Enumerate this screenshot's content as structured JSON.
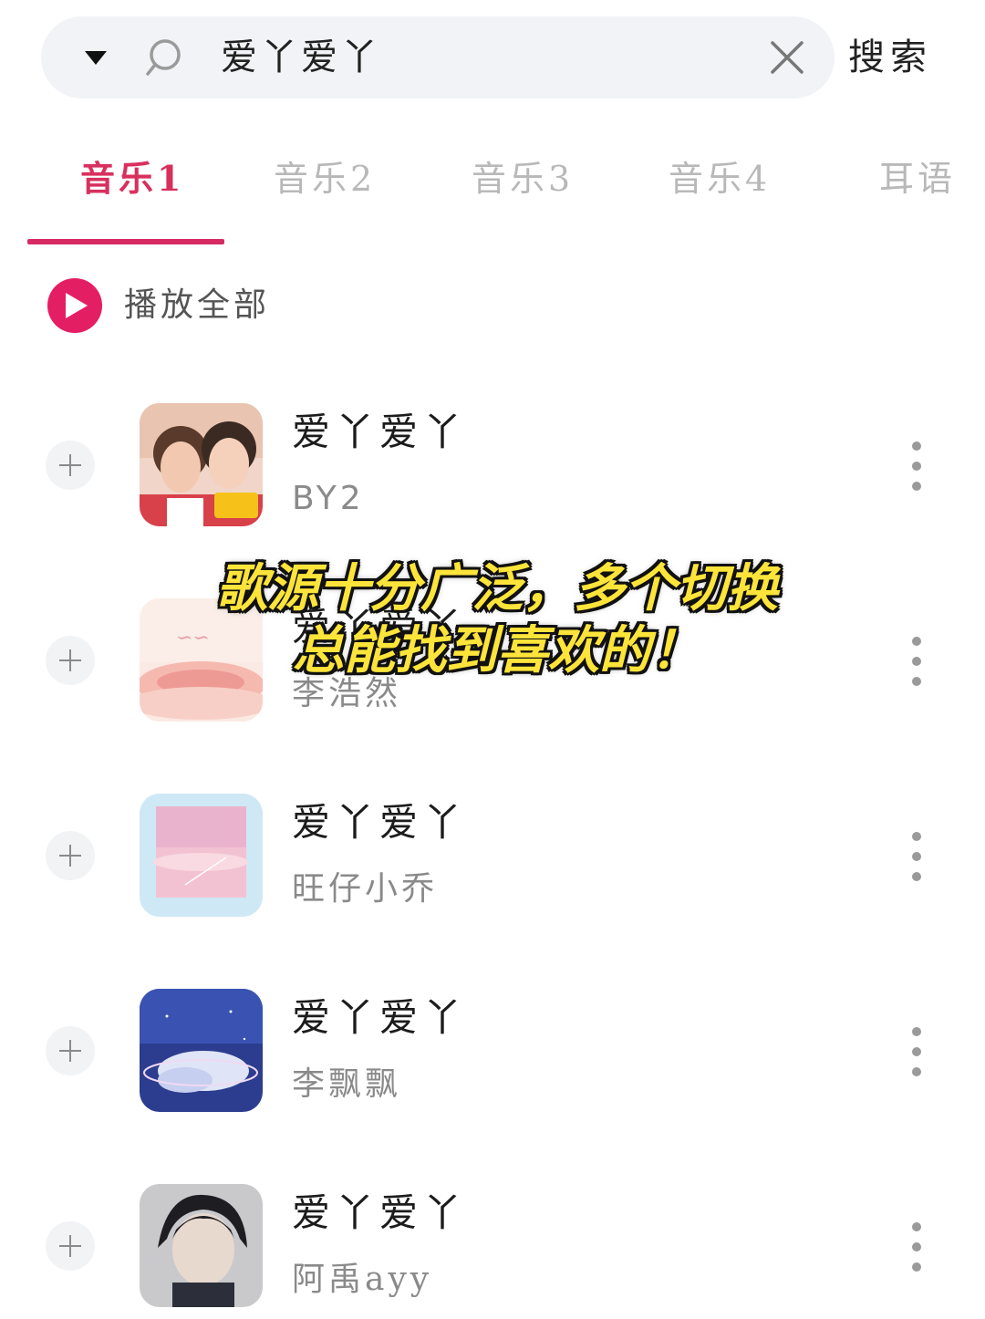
{
  "search": {
    "query": "爱丫爱丫",
    "button_label": "搜索"
  },
  "tabs": [
    {
      "label": "音乐1",
      "active": true
    },
    {
      "label": "音乐2",
      "active": false
    },
    {
      "label": "音乐3",
      "active": false
    },
    {
      "label": "音乐4",
      "active": false
    },
    {
      "label": "耳语",
      "active": false
    }
  ],
  "play_all": {
    "label": "播放全部"
  },
  "songs": [
    {
      "title": "爱丫爱丫",
      "artist": "BY2"
    },
    {
      "title": "爱丫爱丫",
      "artist": "李浩然"
    },
    {
      "title": "爱丫爱丫",
      "artist": "旺仔小乔"
    },
    {
      "title": "爱丫爱丫",
      "artist": "李飘飘"
    },
    {
      "title": "爱丫爱丫",
      "artist": "阿禹ayy"
    }
  ],
  "caption": {
    "line1": "歌源十分广泛，多个切换",
    "line2": "总能找到喜欢的！"
  },
  "colors": {
    "accent": "#d62a62",
    "caption_fill": "#fde43a"
  },
  "icons": [
    "chevron-down-icon",
    "search-icon",
    "close-icon",
    "play-icon",
    "plus-icon",
    "more-vertical-icon"
  ]
}
